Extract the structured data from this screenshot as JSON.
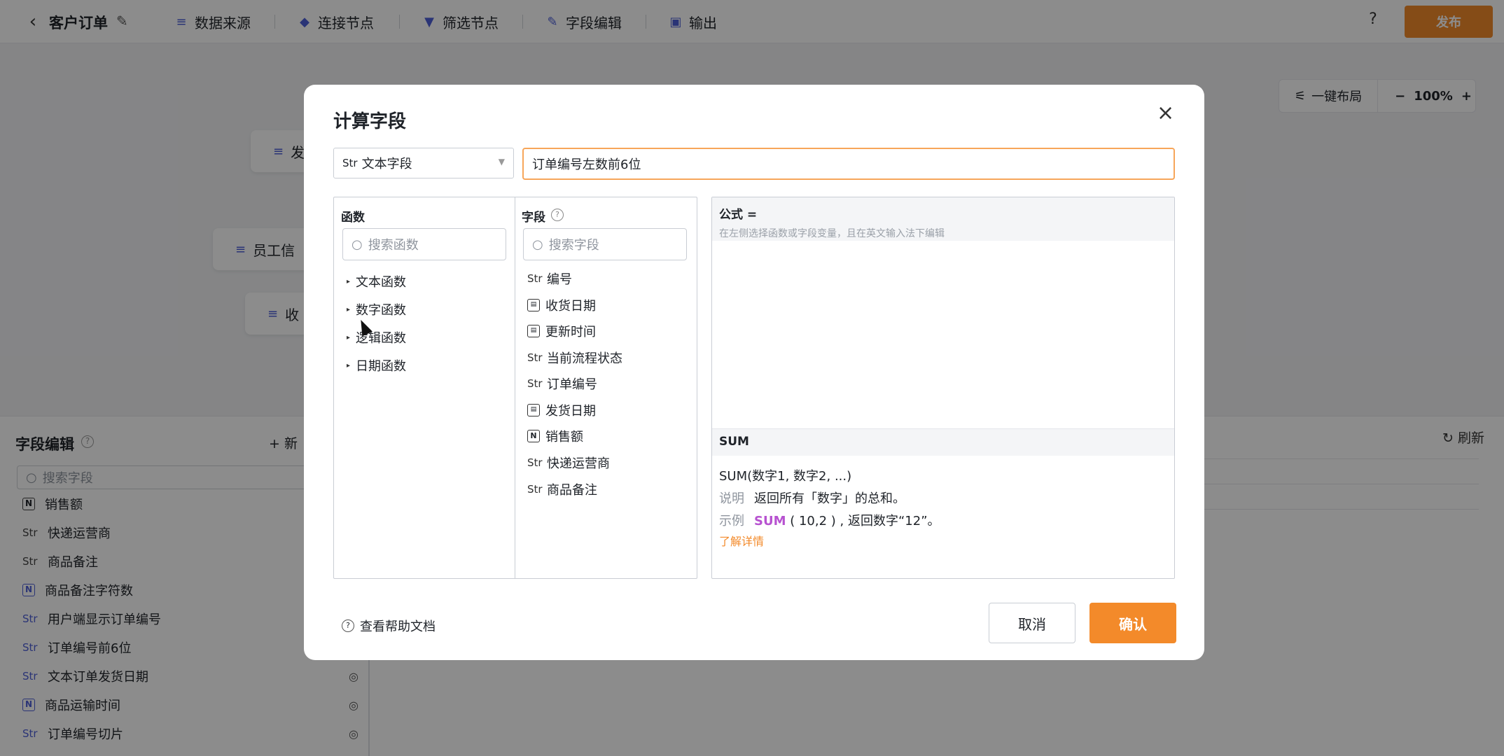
{
  "topbar": {
    "title": "客户订单",
    "items": [
      {
        "label": "数据来源",
        "icon": "database-icon"
      },
      {
        "label": "连接节点",
        "icon": "link-node-icon"
      },
      {
        "label": "筛选节点",
        "icon": "filter-icon"
      },
      {
        "label": "字段编辑",
        "icon": "edit-field-icon"
      },
      {
        "label": "输出",
        "icon": "output-icon"
      }
    ],
    "help": "?",
    "publish": "发布"
  },
  "canvas": {
    "layout_btn": "一键布局",
    "zoom": "100%",
    "nodes": [
      "发",
      "员工信",
      "收"
    ]
  },
  "panel": {
    "title": "字段编辑",
    "new_btn": "+ 新",
    "search_placeholder": "搜索字段",
    "refresh": "刷新",
    "fields": [
      {
        "type": "N",
        "label": "销售额"
      },
      {
        "type": "Str",
        "label": "快递运营商"
      },
      {
        "type": "Str",
        "label": "商品备注"
      },
      {
        "type": "N",
        "label": "商品备注字符数"
      },
      {
        "type": "Str",
        "label": "用户端显示订单编号"
      },
      {
        "type": "Str",
        "label": "订单编号前6位"
      },
      {
        "type": "Str",
        "label": "文本订单发货日期"
      },
      {
        "type": "N",
        "label": "商品运输时间"
      },
      {
        "type": "Str",
        "label": "订单编号切片"
      }
    ]
  },
  "modal": {
    "title": "计算字段",
    "type_prefix": "Str",
    "type_label": "文本字段",
    "name_value": "订单编号左数前6位",
    "functions": {
      "header": "函数",
      "search_placeholder": "搜索函数",
      "categories": [
        "文本函数",
        "数字函数",
        "逻辑函数",
        "日期函数"
      ]
    },
    "fields": {
      "header": "字段",
      "search_placeholder": "搜索字段",
      "items": [
        {
          "type": "Str",
          "label": "编号"
        },
        {
          "type": "date",
          "label": "收货日期"
        },
        {
          "type": "date",
          "label": "更新时间"
        },
        {
          "type": "Str",
          "label": "当前流程状态"
        },
        {
          "type": "Str",
          "label": "订单编号"
        },
        {
          "type": "date",
          "label": "发货日期"
        },
        {
          "type": "N",
          "label": "销售额"
        },
        {
          "type": "Str",
          "label": "快递运营商"
        },
        {
          "type": "Str",
          "label": "商品备注"
        }
      ]
    },
    "formula": {
      "label": "公式 =",
      "hint": "在左侧选择函数或字段变量，且在英文输入法下编辑",
      "fn_name": "SUM",
      "signature": "SUM(数字1, 数字2, ...)",
      "desc_label": "说明",
      "desc": "返回所有「数字」的总和。",
      "example_label": "示例",
      "example_kw": "SUM",
      "example_rest": "( 10,2 ) , 返回数字“12”。",
      "learn_more": "了解详情"
    },
    "help_doc": "查看帮助文档",
    "cancel": "取消",
    "confirm": "确认"
  },
  "colors": {
    "accent": "#f38a2a",
    "focus_border": "#f7a65a",
    "icon_blue": "#4e5fd8",
    "keyword_purple": "#b752d0"
  }
}
